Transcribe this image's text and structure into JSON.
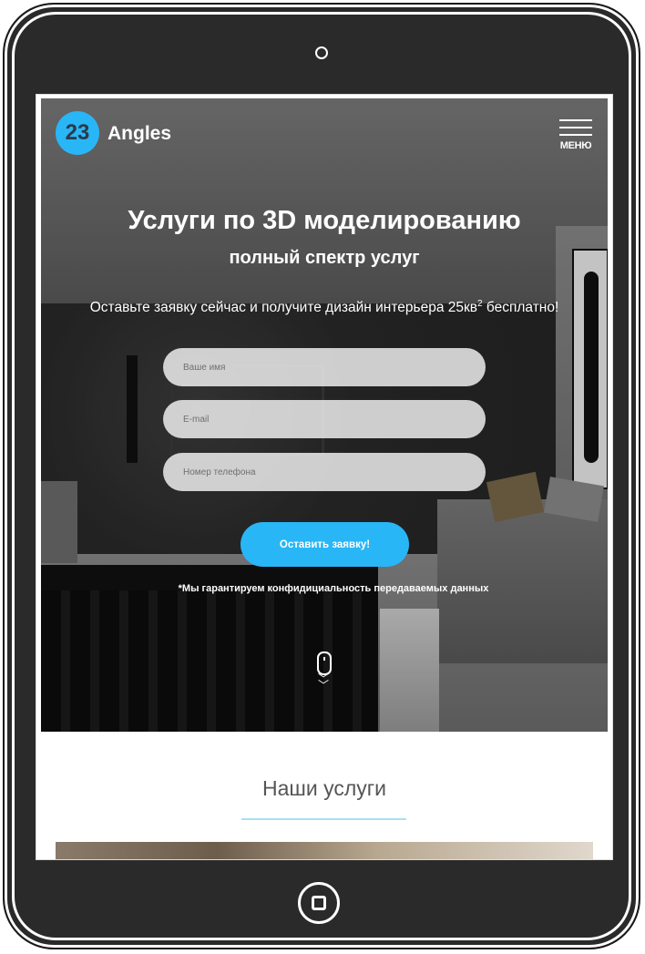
{
  "brand": {
    "logo_number": "23",
    "logo_text": "Angles",
    "accent": "#29b6f6"
  },
  "header": {
    "menu_label": "МЕНЮ"
  },
  "hero": {
    "title": "Услуги по 3D моделированию",
    "subtitle": "полный спектр услуг",
    "offer_text": "Оставьте заявку сейчас и получите дизайн интерьера 25кв",
    "offer_sup": "2",
    "offer_tail": " бесплатно!"
  },
  "form": {
    "name_placeholder": "Ваше имя",
    "email_placeholder": "E-mail",
    "phone_placeholder": "Номер телефона",
    "submit_label": "Оставить заявку!",
    "privacy_note": "*Мы гарантируем конфидициальность передаваемых данных"
  },
  "services": {
    "title": "Наши услуги"
  }
}
